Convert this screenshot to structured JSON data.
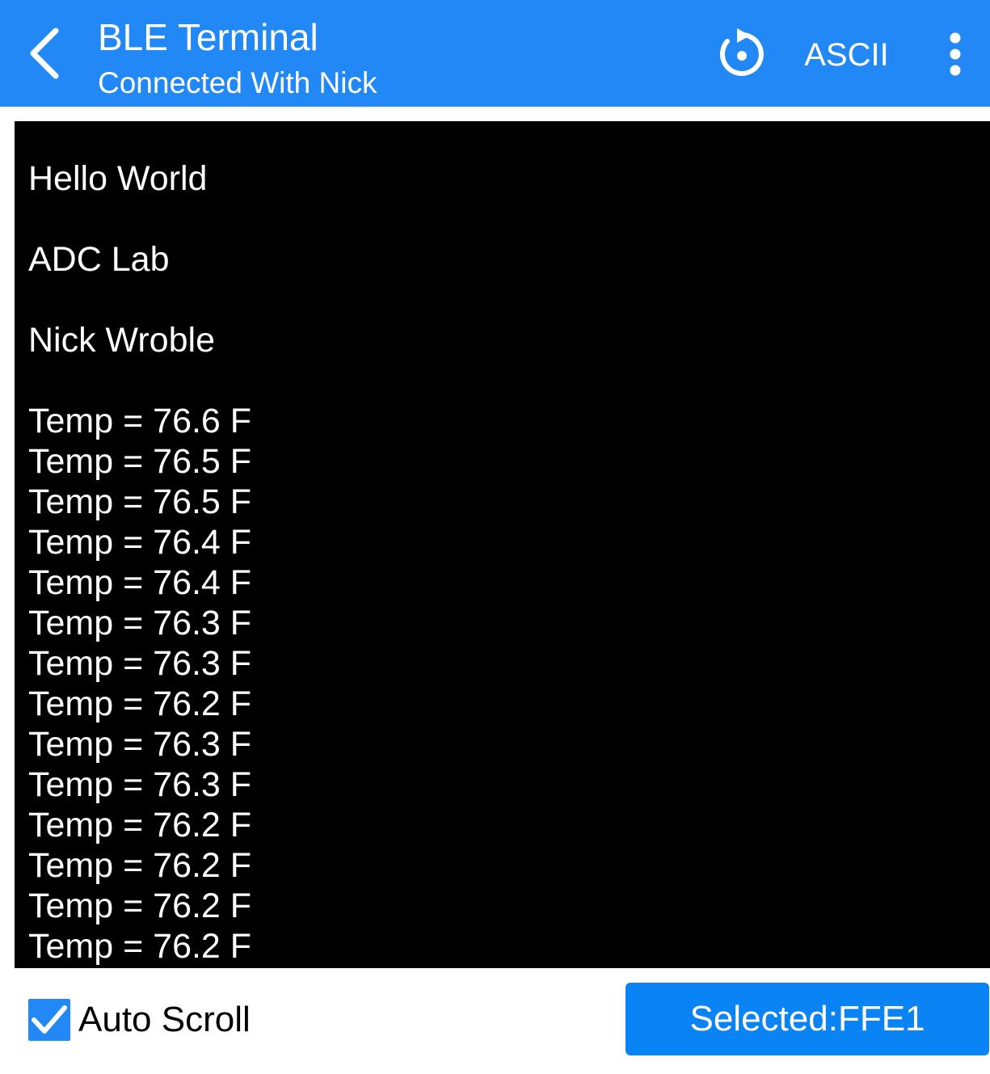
{
  "header": {
    "title": "BLE Terminal",
    "subtitle": "Connected With Nick",
    "mode_label": "ASCII",
    "back_icon": "chevron-left-icon",
    "refresh_icon": "refresh-icon",
    "more_icon": "more-vertical-icon"
  },
  "terminal": {
    "intro": [
      "Hello World",
      "ADC Lab",
      "Nick Wroble"
    ],
    "readings": [
      "Temp = 76.6 F",
      "Temp = 76.5 F",
      "Temp = 76.5 F",
      "Temp = 76.4 F",
      "Temp = 76.4 F",
      "Temp = 76.3 F",
      "Temp = 76.3 F",
      "Temp = 76.2 F",
      "Temp = 76.3 F",
      "Temp = 76.3 F",
      "Temp = 76.2 F",
      "Temp = 76.2 F",
      "Temp = 76.2 F",
      "Temp = 76.2 F"
    ]
  },
  "footer": {
    "auto_scroll_label": "Auto Scroll",
    "auto_scroll_checked": true,
    "selected_label": "Selected:FFE1"
  },
  "colors": {
    "header_bg": "#2288f6",
    "button_bg": "#0a84f5",
    "terminal_bg": "#000000",
    "terminal_text": "#ffffff"
  }
}
